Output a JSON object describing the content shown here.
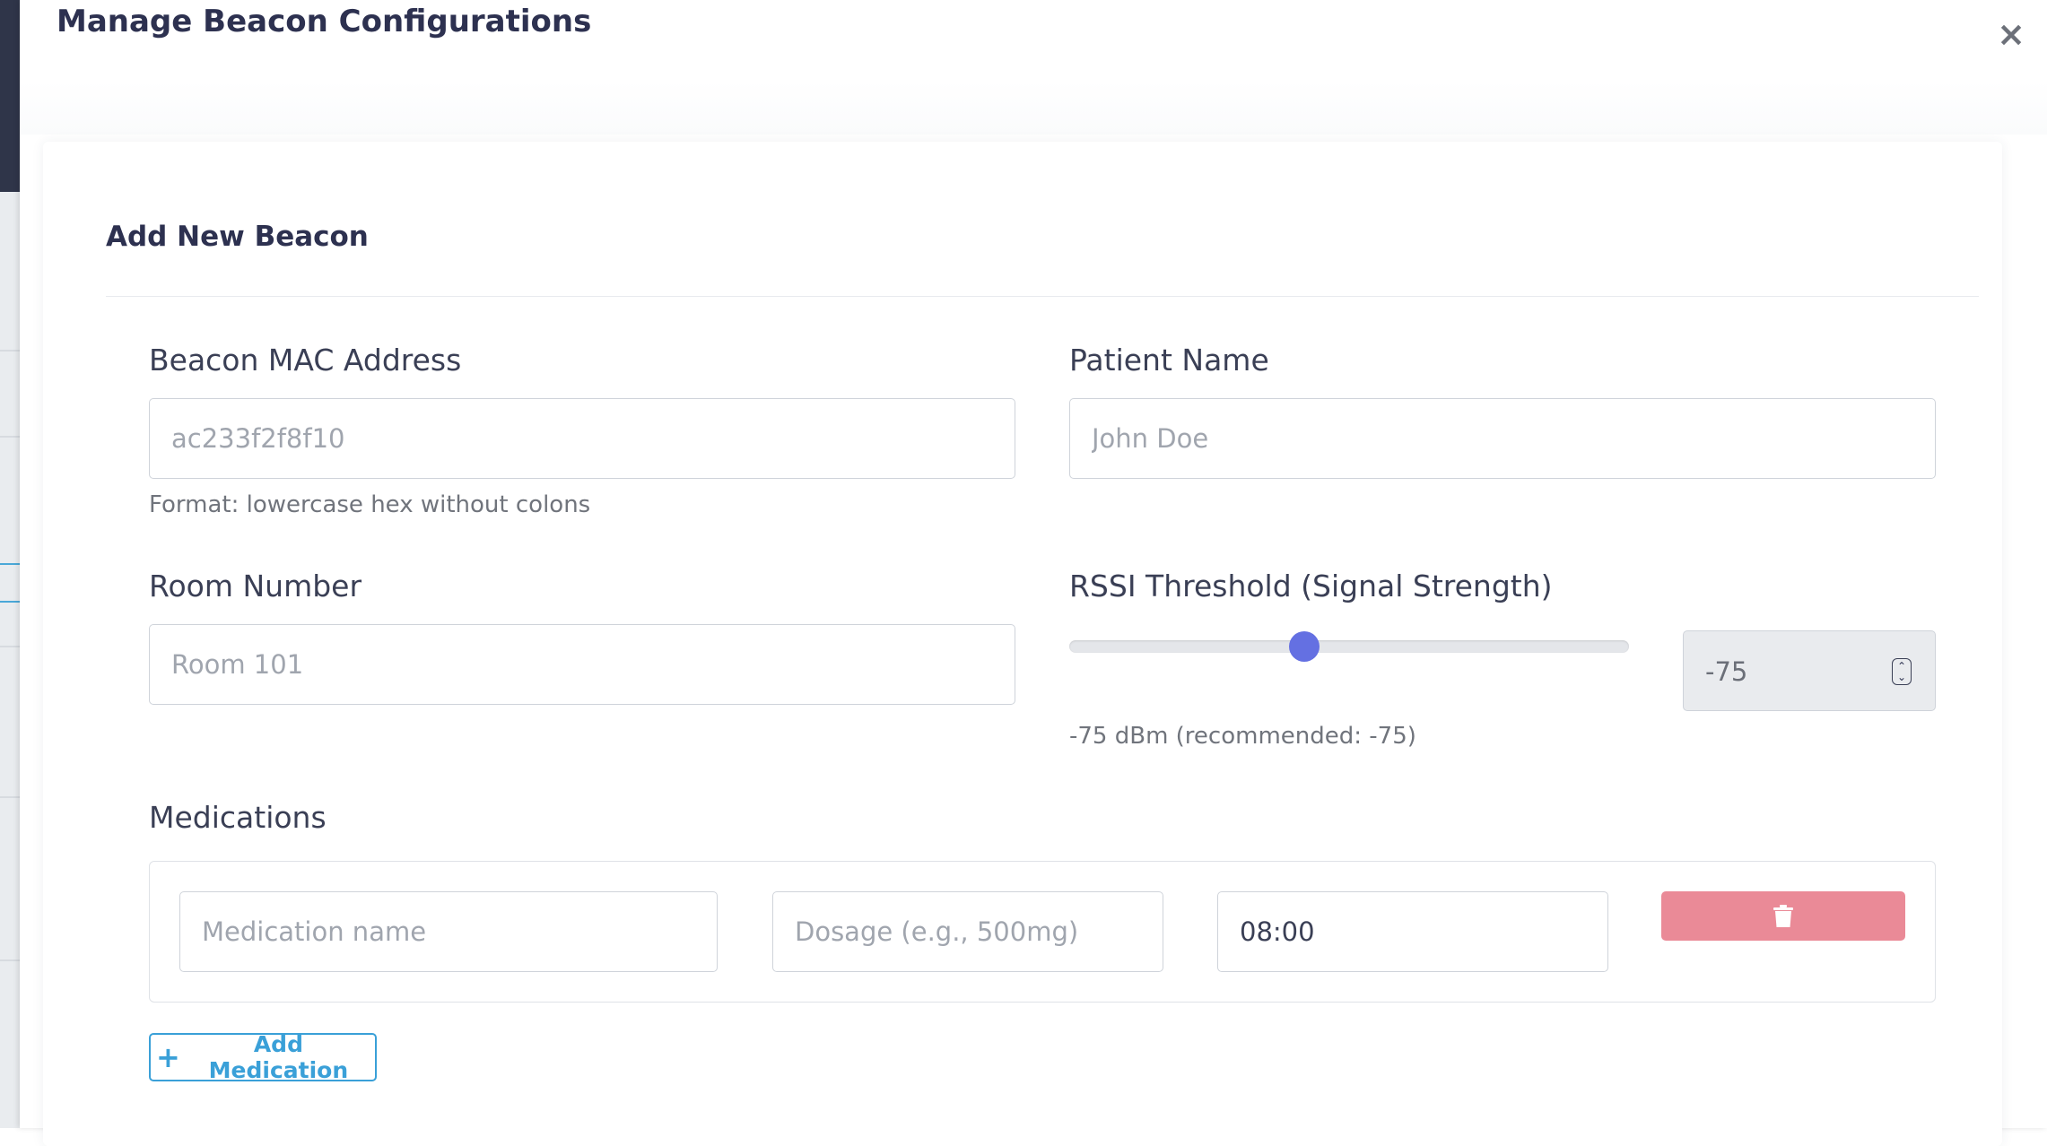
{
  "modal": {
    "title": "Manage Beacon Configurations",
    "close_symbol": "×",
    "close_icon": "close-icon"
  },
  "form": {
    "title": "Add New Beacon",
    "mac": {
      "label": "Beacon MAC Address",
      "placeholder": "ac233f2f8f10",
      "help": "Format: lowercase hex without colons"
    },
    "patient": {
      "label": "Patient Name",
      "placeholder": "John Doe"
    },
    "room": {
      "label": "Room Number",
      "placeholder": "Room 101"
    },
    "rssi": {
      "label": "RSSI Threshold (Signal Strength)",
      "value": "-75",
      "slider_fraction": 0.42,
      "help": "-75 dBm (recommended: -75)",
      "accent_color": "#6470e2"
    },
    "medications": {
      "label": "Medications",
      "rows": [
        {
          "name_placeholder": "Medication name",
          "dosage_placeholder": "Dosage (e.g., 500mg)",
          "time_value": "08:00",
          "delete_icon": "trash-icon",
          "delete_color": "#ea8a97"
        }
      ],
      "add_label": "Add Medication",
      "add_icon_symbol": "+",
      "add_color": "#3aa0d8"
    }
  }
}
